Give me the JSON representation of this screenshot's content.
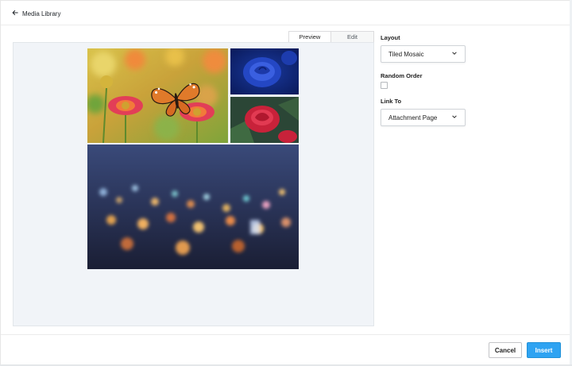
{
  "header": {
    "back_label": "Media Library",
    "back_icon": "arrow-left-icon"
  },
  "preview": {
    "tabs": [
      {
        "label": "Preview",
        "active": true
      },
      {
        "label": "Edit",
        "active": false
      }
    ],
    "gallery": {
      "images": [
        {
          "subject": "butterfly on red daisy flowers"
        },
        {
          "subject": "blue rose"
        },
        {
          "subject": "red rose"
        },
        {
          "subject": "blurred city lights at night"
        }
      ]
    }
  },
  "settings": {
    "layout": {
      "label": "Layout",
      "value": "Tiled Mosaic"
    },
    "random_order": {
      "label": "Random Order",
      "checked": false
    },
    "link_to": {
      "label": "Link To",
      "value": "Attachment Page"
    }
  },
  "footer": {
    "cancel_label": "Cancel",
    "insert_label": "Insert"
  },
  "colors": {
    "accent": "#2ea3f2",
    "preview_bg": "#f1f4f8"
  }
}
